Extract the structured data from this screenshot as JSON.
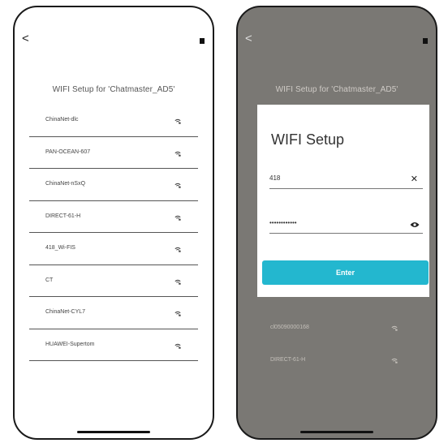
{
  "left_screen": {
    "back": "<",
    "title": "WIFI Setup for 'Chatmaster_AD5'",
    "networks": [
      {
        "ssid": "ChinaNet-dlc"
      },
      {
        "ssid": "PAN-OCEAN-607"
      },
      {
        "ssid": "ChinaNet-nSxQ"
      },
      {
        "ssid": "DIRECT-61-H"
      },
      {
        "ssid": "418_Wi-FIS"
      },
      {
        "ssid": "CT"
      },
      {
        "ssid": "ChinaNet-CYL7"
      },
      {
        "ssid": "HUAWEI-Supertom"
      }
    ]
  },
  "right_screen": {
    "back": "<",
    "title": "WIFI Setup for 'Chatmaster_AD5'",
    "background_networks": [
      {
        "ssid": "cl05090000168"
      },
      {
        "ssid": "DIRECT-61-H"
      }
    ],
    "dialog": {
      "title": "WIFI Setup",
      "ssid_value": "418",
      "password_value": "••••••••••••",
      "enter_label": "Enter"
    }
  },
  "colors": {
    "accent": "#23b7cf",
    "overlay": "#7a7874"
  },
  "icons": {
    "wifi": "wifi-lock-icon",
    "clear": "close-icon",
    "visibility": "eye-icon"
  }
}
